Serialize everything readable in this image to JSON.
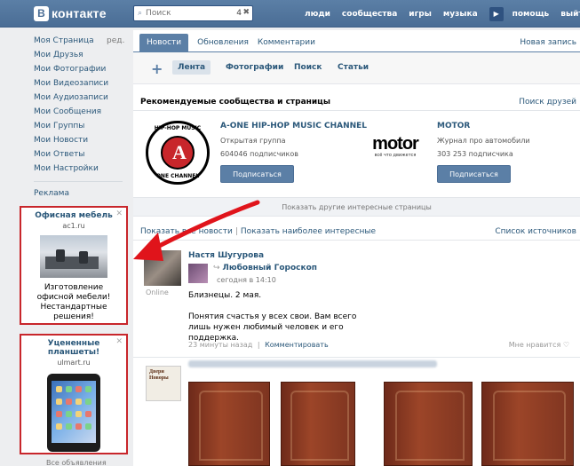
{
  "header": {
    "logo_letter": "В",
    "logo_text": "контакте",
    "search_placeholder": "Поиск",
    "search_count": "4",
    "search_clear": "✖",
    "nav": [
      "люди",
      "сообщества",
      "игры",
      "музыка",
      "помощь",
      "выйт"
    ],
    "play_icon": "▶"
  },
  "sidebar": {
    "edit_label": "ред.",
    "items": [
      "Моя Страница",
      "Мои Друзья",
      "Мои Фотографии",
      "Мои Видеозаписи",
      "Мои Аудиозаписи",
      "Мои Сообщения",
      "Мои Группы",
      "Мои Новости",
      "Мои Ответы",
      "Мои Настройки"
    ],
    "ads_link": "Реклама"
  },
  "ads": [
    {
      "title": "Офисная мебель",
      "domain": "ac1.ru",
      "desc_lines": [
        "Изготовление",
        "офисной мебели!",
        "Нестандартные",
        "решения!"
      ]
    },
    {
      "title_lines": [
        "Уцененные",
        "планшеты!"
      ],
      "domain": "ulmart.ru"
    }
  ],
  "all_ads": "Все объявления",
  "main": {
    "tabs": [
      "Новости",
      "Обновления",
      "Комментарии"
    ],
    "new_post": "Новая запись",
    "plus": "+",
    "subtabs": [
      "Лента",
      "Фотографии",
      "Поиск",
      "Статьи"
    ],
    "rec_title": "Рекомендуемые сообщества и страницы",
    "rec_search": "Поиск друзей",
    "communities": [
      {
        "name": "A-ONE HIP-HOP MUSIC CHANNEL",
        "type": "Открытая группа",
        "subs": "604046 подписчиков",
        "button": "Подписаться",
        "logo_top": "HIP-HOP MUSIC",
        "logo_letter": "A",
        "logo_bottom": "ONE CHANNEL"
      },
      {
        "name": "MOTOR",
        "type": "Журнал про автомобили",
        "subs": "303 253 подписчика",
        "button": "Подписаться",
        "logo_word": "motor",
        "logo_slogan": "всё что движется"
      }
    ],
    "more_pages": "Показать другие интересные страницы",
    "news_filter_1": "Показать все новости",
    "news_filter_divider": "|",
    "news_filter_2": "Показать наиболее интересные",
    "sources": "Список источников",
    "post": {
      "author": "Настя Шугурова",
      "online": "Online",
      "shared_group": "Любовный Гороскоп",
      "shared_time": "сегодня в 14:10",
      "text_lines": [
        "Близнецы. 2 мая.",
        "",
        "Понятия счастья у всех свои. Вам всего",
        "лишь нужен любимый человек и его поддержка."
      ],
      "time_ago": "23 минуты назад",
      "meta_divider": "|",
      "comment": "Комментировать",
      "like": "Мне нравится ♡"
    },
    "doors_logo_text": "Двери Новоры"
  },
  "colors": {
    "brand": "#5b7fa6",
    "link": "#2b587a",
    "highlight": "#c8262b"
  }
}
